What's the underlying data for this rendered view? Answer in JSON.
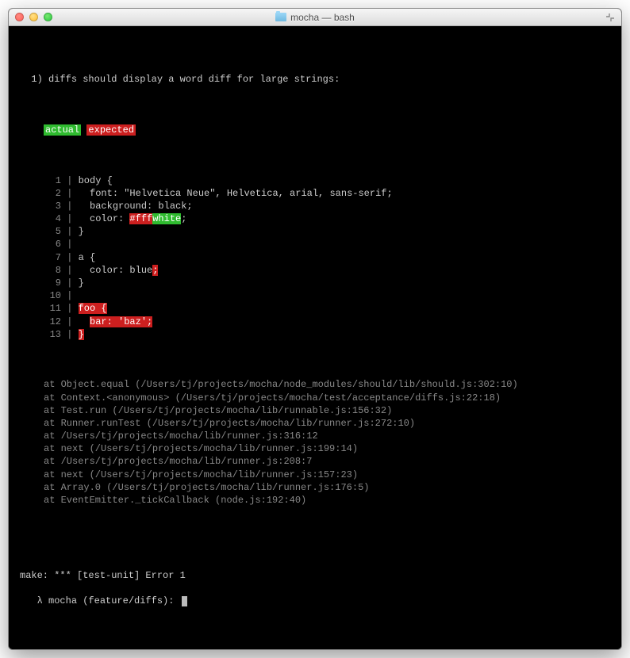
{
  "window": {
    "title": "mocha — bash"
  },
  "test": {
    "number": "1)",
    "title": "diffs should display a word diff for large strings:"
  },
  "legend": {
    "actual": "actual",
    "expected": "expected"
  },
  "diff_lines": [
    {
      "n": "1",
      "segs": [
        {
          "t": " body {",
          "c": ""
        }
      ]
    },
    {
      "n": "2",
      "segs": [
        {
          "t": "   font: \"Helvetica Neue\", Helvetica, arial, sans-serif;",
          "c": ""
        }
      ]
    },
    {
      "n": "3",
      "segs": [
        {
          "t": "   background: black;",
          "c": ""
        }
      ]
    },
    {
      "n": "4",
      "segs": [
        {
          "t": "   color: ",
          "c": ""
        },
        {
          "t": "#fff",
          "c": "hl-red"
        },
        {
          "t": "white",
          "c": "hl-green"
        },
        {
          "t": ";",
          "c": ""
        }
      ]
    },
    {
      "n": "5",
      "segs": [
        {
          "t": " }",
          "c": ""
        }
      ]
    },
    {
      "n": "6",
      "segs": []
    },
    {
      "n": "7",
      "segs": [
        {
          "t": " a {",
          "c": ""
        }
      ]
    },
    {
      "n": "8",
      "segs": [
        {
          "t": "   color: blue",
          "c": ""
        },
        {
          "t": ";",
          "c": "hl-red"
        }
      ]
    },
    {
      "n": "9",
      "segs": [
        {
          "t": " }",
          "c": ""
        }
      ]
    },
    {
      "n": "10",
      "segs": []
    },
    {
      "n": "11",
      "segs": [
        {
          "t": " ",
          "c": ""
        },
        {
          "t": "foo {",
          "c": "hl-red"
        }
      ]
    },
    {
      "n": "12",
      "segs": [
        {
          "t": "   ",
          "c": ""
        },
        {
          "t": "bar: 'baz';",
          "c": "hl-red"
        }
      ]
    },
    {
      "n": "13",
      "segs": [
        {
          "t": " ",
          "c": ""
        },
        {
          "t": "}",
          "c": "hl-red"
        }
      ]
    }
  ],
  "stack": [
    "at Object.equal (/Users/tj/projects/mocha/node_modules/should/lib/should.js:302:10)",
    "at Context.<anonymous> (/Users/tj/projects/mocha/test/acceptance/diffs.js:22:18)",
    "at Test.run (/Users/tj/projects/mocha/lib/runnable.js:156:32)",
    "at Runner.runTest (/Users/tj/projects/mocha/lib/runner.js:272:10)",
    "at /Users/tj/projects/mocha/lib/runner.js:316:12",
    "at next (/Users/tj/projects/mocha/lib/runner.js:199:14)",
    "at /Users/tj/projects/mocha/lib/runner.js:208:7",
    "at next (/Users/tj/projects/mocha/lib/runner.js:157:23)",
    "at Array.0 (/Users/tj/projects/mocha/lib/runner.js:176:5)",
    "at EventEmitter._tickCallback (node.js:192:40)"
  ],
  "make_error": "make: *** [test-unit] Error 1",
  "prompt": {
    "symbol": "λ",
    "text": "mocha (feature/diffs): "
  }
}
